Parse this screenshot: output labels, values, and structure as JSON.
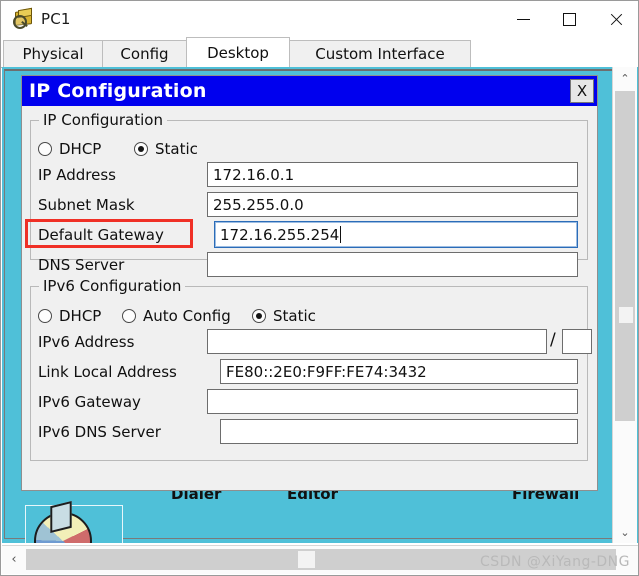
{
  "window": {
    "title": "PC1",
    "icon": "packet-tracer-pc-icon",
    "controls": {
      "minimize": "—",
      "maximize": "□",
      "close": "✕"
    }
  },
  "tabs": [
    {
      "label": "Physical",
      "active": false
    },
    {
      "label": "Config",
      "active": false
    },
    {
      "label": "Desktop",
      "active": true
    },
    {
      "label": "Custom Interface",
      "active": false
    }
  ],
  "dialog": {
    "title": "IP Configuration",
    "close_label": "X",
    "ipv4": {
      "legend": "IP Configuration",
      "mode_options": [
        {
          "label": "DHCP",
          "selected": false
        },
        {
          "label": "Static",
          "selected": true
        }
      ],
      "fields": [
        {
          "label": "IP Address",
          "value": "172.16.0.1",
          "focused": false
        },
        {
          "label": "Subnet Mask",
          "value": "255.255.0.0",
          "focused": false
        },
        {
          "label": "Default Gateway",
          "value": "172.16.255.254",
          "focused": true
        },
        {
          "label": "DNS Server",
          "value": "",
          "focused": false
        }
      ]
    },
    "ipv6": {
      "legend": "IPv6 Configuration",
      "mode_options": [
        {
          "label": "DHCP",
          "selected": false
        },
        {
          "label": "Auto Config",
          "selected": false
        },
        {
          "label": "Static",
          "selected": true
        }
      ],
      "address_label": "IPv6 Address",
      "address_value": "",
      "prefix_separator": "/",
      "prefix_value": "",
      "fields": [
        {
          "label": "Link Local Address",
          "value": "FE80::2E0:F9FF:FE74:3432"
        },
        {
          "label": "IPv6 Gateway",
          "value": ""
        },
        {
          "label": "IPv6 DNS Server",
          "value": ""
        }
      ]
    }
  },
  "annotation": {
    "target": "Default Gateway",
    "color": "#f03026"
  },
  "desktop": {
    "background_color": "#4fc0d8",
    "icon_labels": [
      "Dialer",
      "Editor",
      "Firewall"
    ],
    "visible_icon": "pie-chart-icon"
  },
  "scrollbars": {
    "vertical": {
      "up": "⌃",
      "down": "⌄"
    },
    "horizontal": {
      "left": "‹"
    }
  },
  "watermark": "CSDN @XiYang-DNG",
  "colors": {
    "dialog_title_bg": "#0000ee",
    "desktop_cyan": "#4fc0d8",
    "annotation_red": "#f03026",
    "focus_blue": "#2b6cb8"
  }
}
